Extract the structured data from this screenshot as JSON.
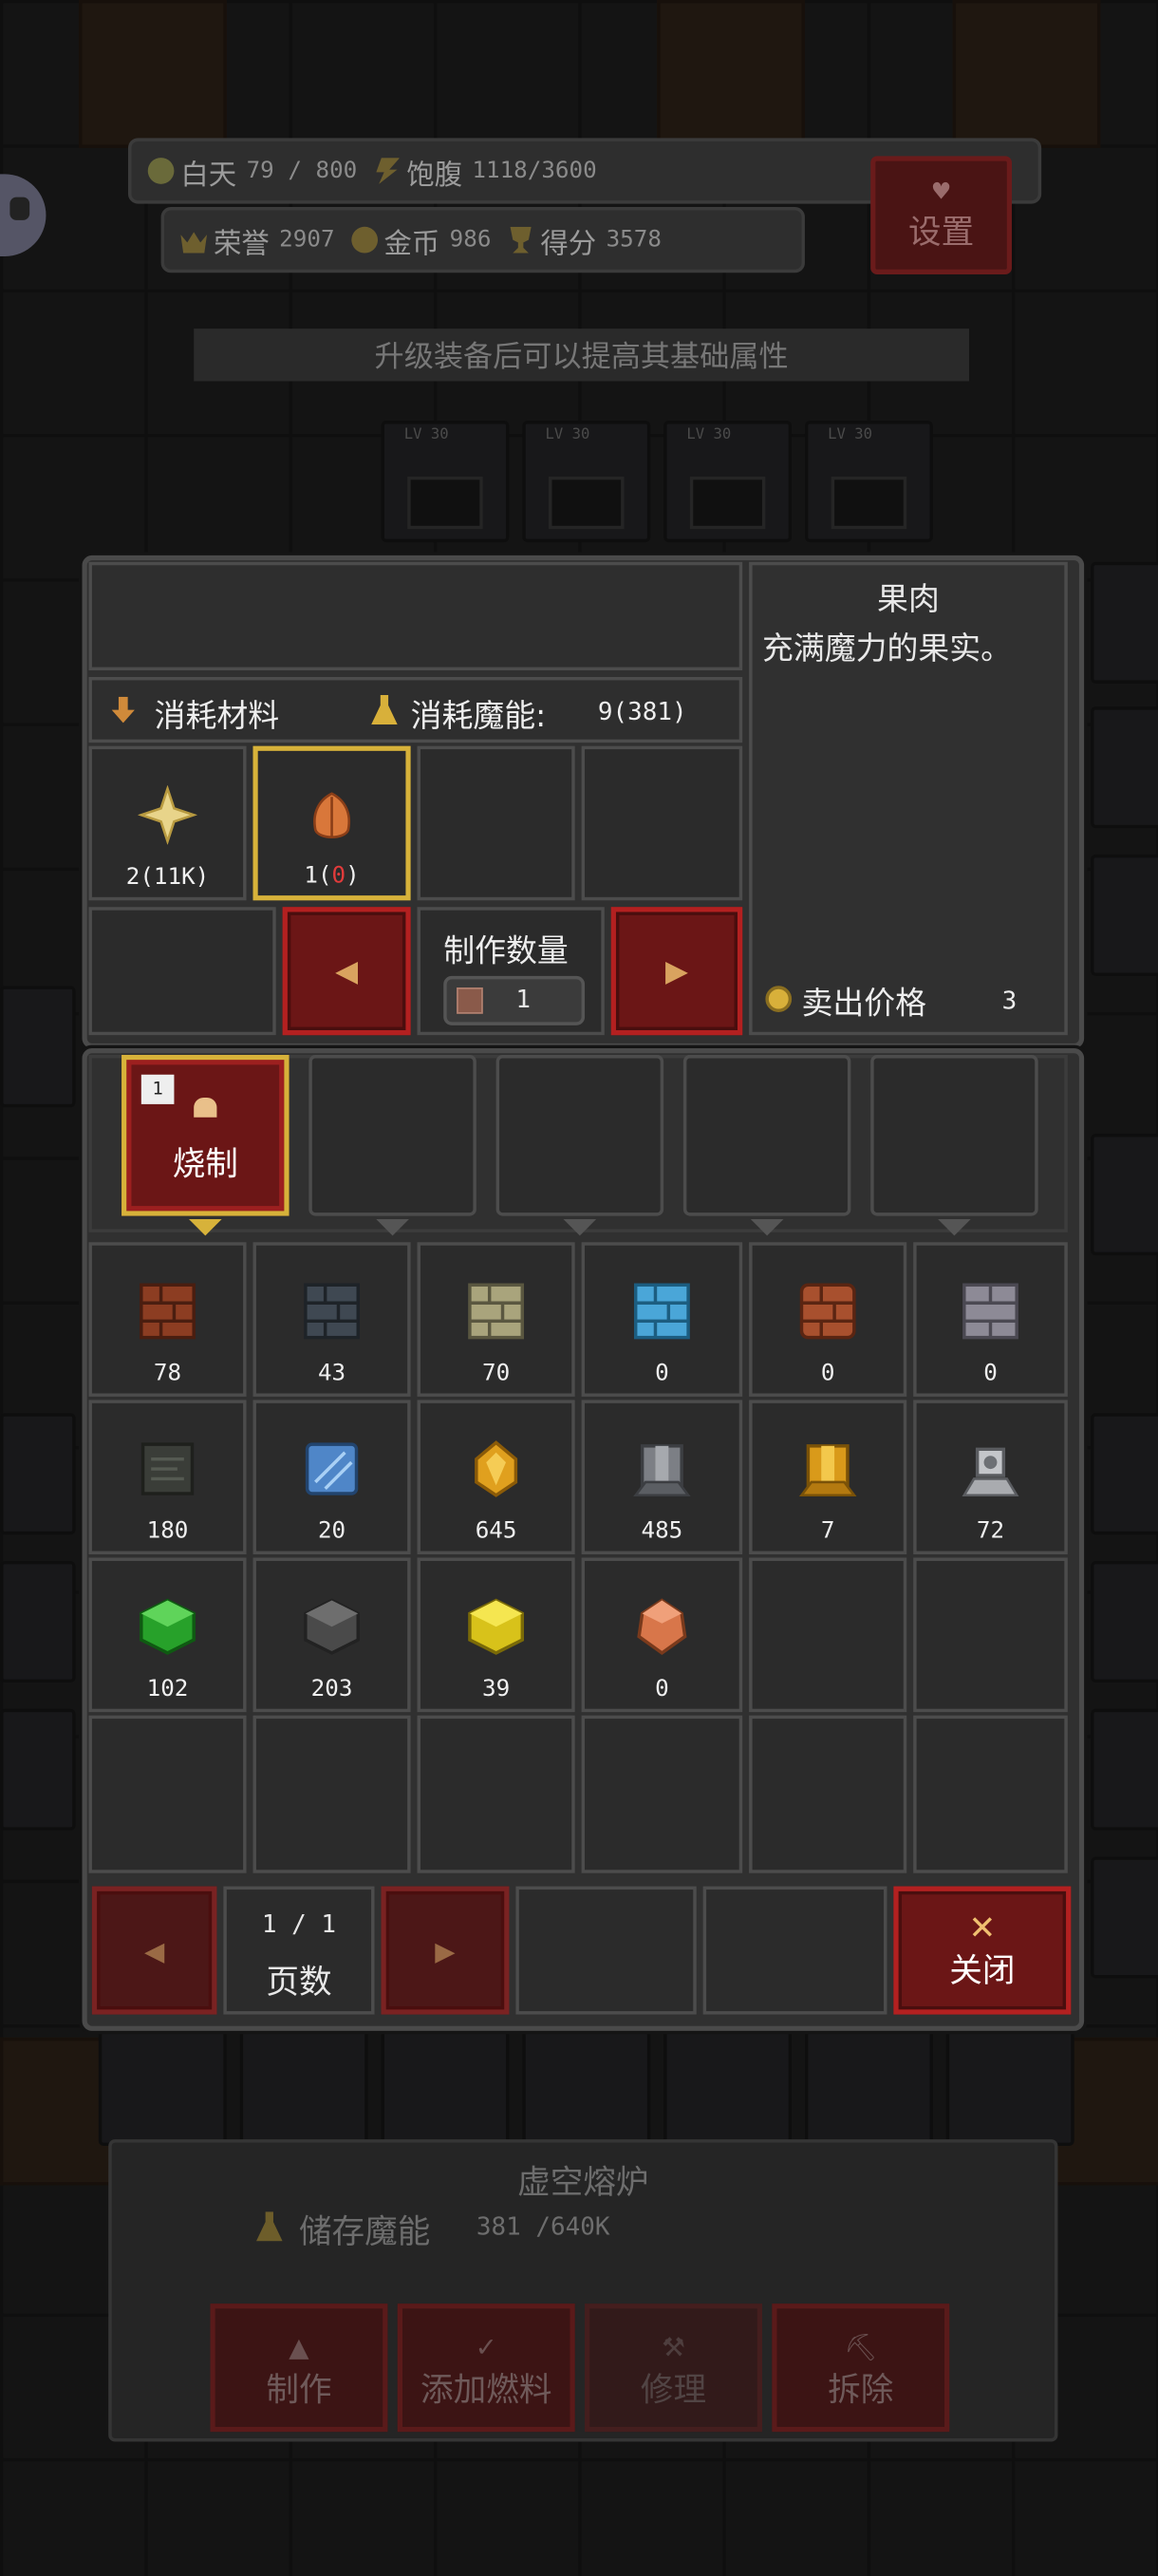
{
  "hud": {
    "day_label": "白天",
    "day_value": "79 / 800",
    "hunger_label": "饱腹",
    "hunger_value": "1118/3600",
    "honor_label": "荣誉",
    "honor_value": "2907",
    "gold_label": "金币",
    "gold_value": "986",
    "score_label": "得分",
    "score_value": "3578",
    "settings_label": "设置",
    "hint": "升级装备后可以提高其基础属性"
  },
  "craft": {
    "materials_label": "消耗材料",
    "mana_label": "消耗魔能:",
    "mana_value": "9(381)",
    "ingredients": [
      {
        "icon": "star-icon",
        "count_prefix": "2(11K)",
        "count_red": "",
        "count_suffix": ""
      },
      {
        "icon": "fruit-icon",
        "count_prefix": "1(",
        "count_red": "0",
        "count_suffix": ")"
      }
    ],
    "quantity_label": "制作数量",
    "quantity_value": "1",
    "item_name": "果肉",
    "item_desc": "充满魔力的果实。",
    "sell_label": "卖出价格",
    "sell_value": "3"
  },
  "tabs": [
    {
      "badge": "1",
      "label": "烧制",
      "active": true
    },
    {
      "badge": "",
      "label": "",
      "active": false
    },
    {
      "badge": "",
      "label": "",
      "active": false
    },
    {
      "badge": "",
      "label": "",
      "active": false
    },
    {
      "badge": "",
      "label": "",
      "active": false
    }
  ],
  "inventory": [
    {
      "name": "red-brick-icon",
      "count": "78"
    },
    {
      "name": "dark-stone-brick-icon",
      "count": "43"
    },
    {
      "name": "sand-brick-icon",
      "count": "70"
    },
    {
      "name": "ice-brick-icon",
      "count": "0"
    },
    {
      "name": "copper-brick-icon",
      "count": "0"
    },
    {
      "name": "gray-brick-icon",
      "count": "0"
    },
    {
      "name": "dark-tablet-icon",
      "count": "180"
    },
    {
      "name": "glass-icon",
      "count": "20"
    },
    {
      "name": "amber-crystal-icon",
      "count": "645"
    },
    {
      "name": "iron-ingot-icon",
      "count": "485"
    },
    {
      "name": "gold-ingot-icon",
      "count": "7"
    },
    {
      "name": "silver-ore-icon",
      "count": "72"
    },
    {
      "name": "green-cube-icon",
      "count": "102"
    },
    {
      "name": "gray-cube-icon",
      "count": "203"
    },
    {
      "name": "yellow-cube-icon",
      "count": "39"
    },
    {
      "name": "copper-ore-icon",
      "count": "0"
    }
  ],
  "pager": {
    "page": "1 / 1",
    "page_label": "页数",
    "close_label": "关闭"
  },
  "building": {
    "name": "虚空熔炉",
    "storage_label": "储存魔能",
    "storage_value": "381 /640K",
    "actions": [
      "制作",
      "添加燃料",
      "修理",
      "拆除"
    ]
  },
  "colors": {
    "accent_gold": "#d7b23a",
    "button_red": "#b32020",
    "panel_bg": "#303030"
  }
}
